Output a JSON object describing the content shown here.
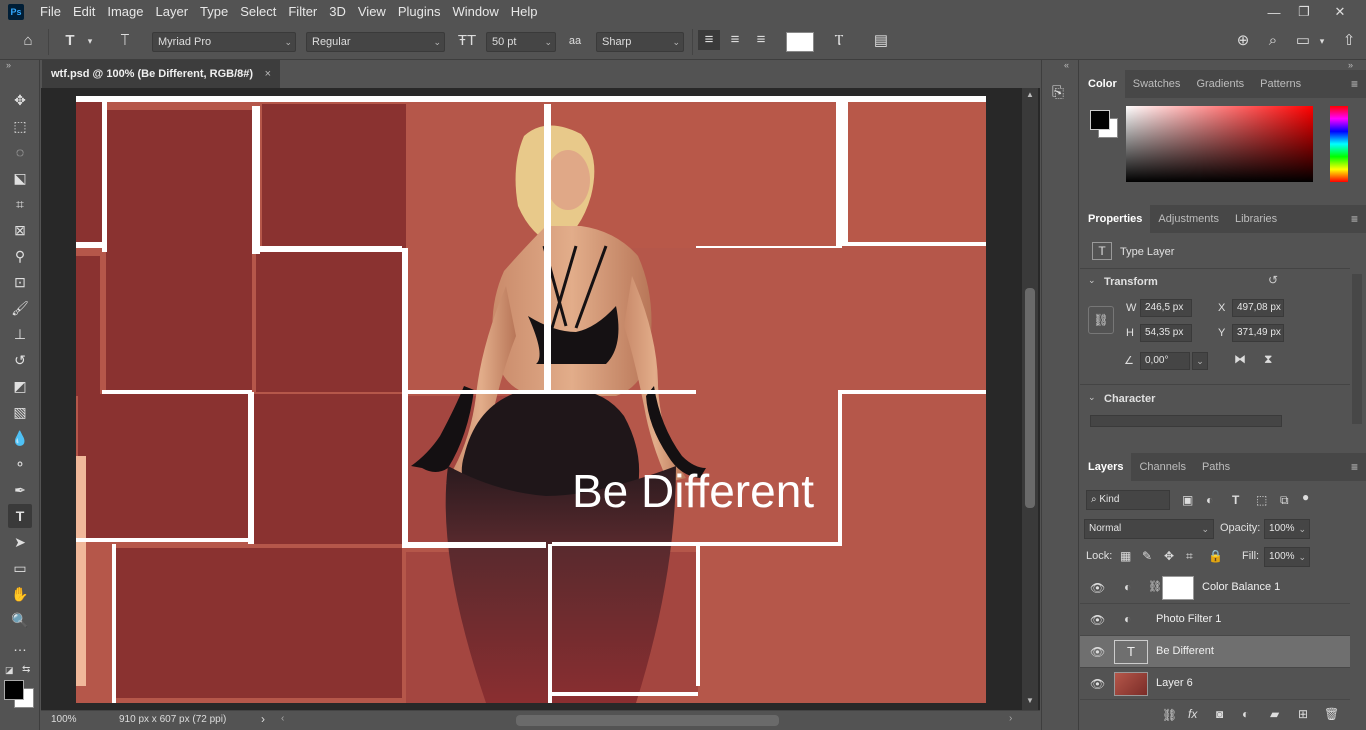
{
  "app": {
    "logo": "Ps"
  },
  "menu": [
    "File",
    "Edit",
    "Image",
    "Layer",
    "Type",
    "Select",
    "Filter",
    "3D",
    "View",
    "Plugins",
    "Window",
    "Help"
  ],
  "window_controls": {
    "minimize": "—",
    "restore": "❐",
    "close": "✕"
  },
  "options": {
    "font_family": "Myriad Pro",
    "font_style": "Regular",
    "font_size": "50 pt",
    "antialias_symbol": "aa",
    "antialias": "Sharp"
  },
  "document": {
    "tab_title": "wtf.psd @ 100% (Be Different, RGB/8#)",
    "tab_close": "×",
    "canvas_text": "Be Different"
  },
  "status": {
    "zoom": "100%",
    "doc_info": "910 px x 607 px (72 ppi)",
    "arrow": "›"
  },
  "color_panel": {
    "tabs": [
      "Color",
      "Swatches",
      "Gradients",
      "Patterns"
    ],
    "foreground": "#000000",
    "background": "#ffffff"
  },
  "properties_panel": {
    "tabs": [
      "Properties",
      "Adjustments",
      "Libraries"
    ],
    "layer_type": "Type Layer",
    "transform_title": "Transform",
    "w_label": "W",
    "w": "246,5 px",
    "h_label": "H",
    "h": "54,35 px",
    "x_label": "X",
    "x": "497,08 px",
    "y_label": "Y",
    "y": "371,49 px",
    "angle": "0,00°",
    "character_title": "Character"
  },
  "layers_panel": {
    "tabs": [
      "Layers",
      "Channels",
      "Paths"
    ],
    "filter_kind": "Kind",
    "blend_mode": "Normal",
    "opacity_label": "Opacity:",
    "opacity": "100%",
    "lock_label": "Lock:",
    "fill_label": "Fill:",
    "fill": "100%",
    "layers": [
      {
        "name": "Color Balance 1",
        "kind": "adjustment"
      },
      {
        "name": "Photo Filter 1",
        "kind": "adjustment"
      },
      {
        "name": "Be Different",
        "kind": "type",
        "selected": true
      },
      {
        "name": "Layer 6",
        "kind": "pixel"
      }
    ]
  },
  "colors": {
    "canvas_bg": "#b5574a",
    "tile_dark": "#8a3230",
    "ui_bg": "#535353",
    "ui_dark": "#282828"
  }
}
